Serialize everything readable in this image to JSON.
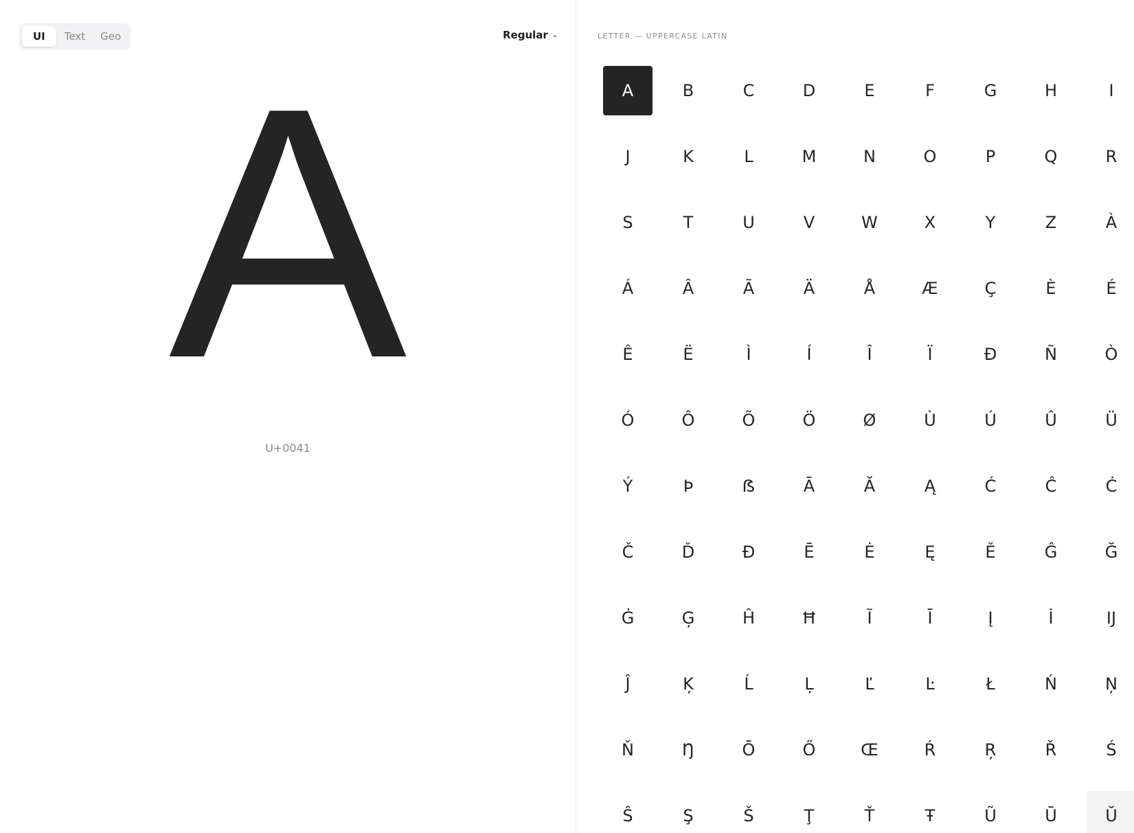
{
  "tabs": [
    {
      "label": "UI",
      "active": true
    },
    {
      "label": "Text",
      "active": false
    },
    {
      "label": "Geo",
      "active": false
    }
  ],
  "weight": {
    "label": "Regular"
  },
  "preview": {
    "glyph": "A",
    "codepoint": "U+0041"
  },
  "category": {
    "label": "LETTER — UPPERCASE LATIN"
  },
  "glyphs": [
    "A",
    "B",
    "C",
    "D",
    "E",
    "F",
    "G",
    "H",
    "I",
    "J",
    "K",
    "L",
    "M",
    "N",
    "O",
    "P",
    "Q",
    "R",
    "S",
    "T",
    "U",
    "V",
    "W",
    "X",
    "Y",
    "Z",
    "À",
    "Á",
    "Â",
    "Ã",
    "Ä",
    "Å",
    "Æ",
    "Ç",
    "È",
    "É",
    "Ê",
    "Ë",
    "Ì",
    "Í",
    "Î",
    "Ï",
    "Ð",
    "Ñ",
    "Ò",
    "Ó",
    "Ô",
    "Õ",
    "Ö",
    "Ø",
    "Ù",
    "Ú",
    "Û",
    "Ü",
    "Ý",
    "Þ",
    "ẞ",
    "Ā",
    "Ă",
    "Ą",
    "Ć",
    "Ĉ",
    "Ċ",
    "Č",
    "Ď",
    "Đ",
    "Ē",
    "Ė",
    "Ę",
    "Ě",
    "Ĝ",
    "Ğ",
    "Ġ",
    "Ģ",
    "Ĥ",
    "Ħ",
    "Ĩ",
    "Ī",
    "Į",
    "İ",
    "Ĳ",
    "Ĵ",
    "Ķ",
    "Ĺ",
    "Ļ",
    "Ľ",
    "Ŀ",
    "Ł",
    "Ń",
    "Ņ",
    "Ň",
    "Ŋ",
    "Ō",
    "Ő",
    "Œ",
    "Ŕ",
    "Ŗ",
    "Ř",
    "Ś",
    "Ŝ",
    "Ş",
    "Š",
    "Ţ",
    "Ť",
    "Ŧ",
    "Ũ",
    "Ū",
    "Ŭ"
  ],
  "selected_index": 0,
  "hovered_index": 107,
  "colors": {
    "ink": "#242424",
    "selected_bg": "#242424",
    "selected_fg": "#ffffff",
    "muted": "#8a8a8a"
  }
}
